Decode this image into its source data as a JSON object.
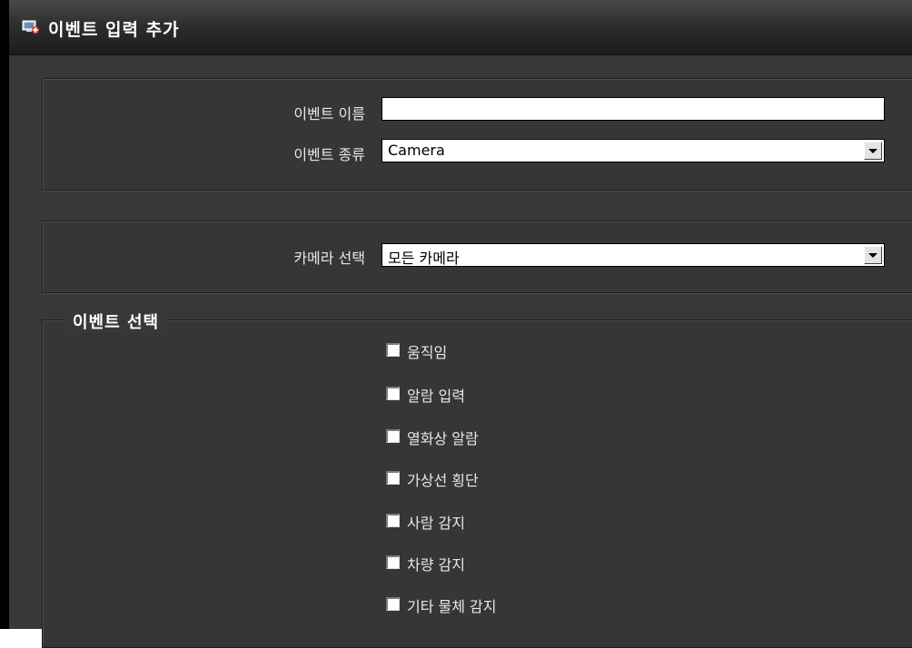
{
  "window": {
    "title": "이벤트 입력 추가"
  },
  "event_info": {
    "name_label": "이벤트 이름",
    "name_value": "",
    "type_label": "이벤트 종류",
    "type_value": "Camera"
  },
  "camera": {
    "label": "카메라 선택",
    "value": "모든 카메라"
  },
  "event_select": {
    "title": "이벤트 선택",
    "options": [
      {
        "label": "움직임",
        "checked": false
      },
      {
        "label": "알람 입력",
        "checked": false
      },
      {
        "label": "열화상 알람",
        "checked": false
      },
      {
        "label": "가상선 횡단",
        "checked": false
      },
      {
        "label": "사람 감지",
        "checked": false
      },
      {
        "label": "차량 감지",
        "checked": false
      },
      {
        "label": "기타 물체 감지",
        "checked": false
      }
    ]
  },
  "colors": {
    "background": "#383838",
    "titlebar": "#2e2e2e",
    "text": "#e8e8e8"
  }
}
